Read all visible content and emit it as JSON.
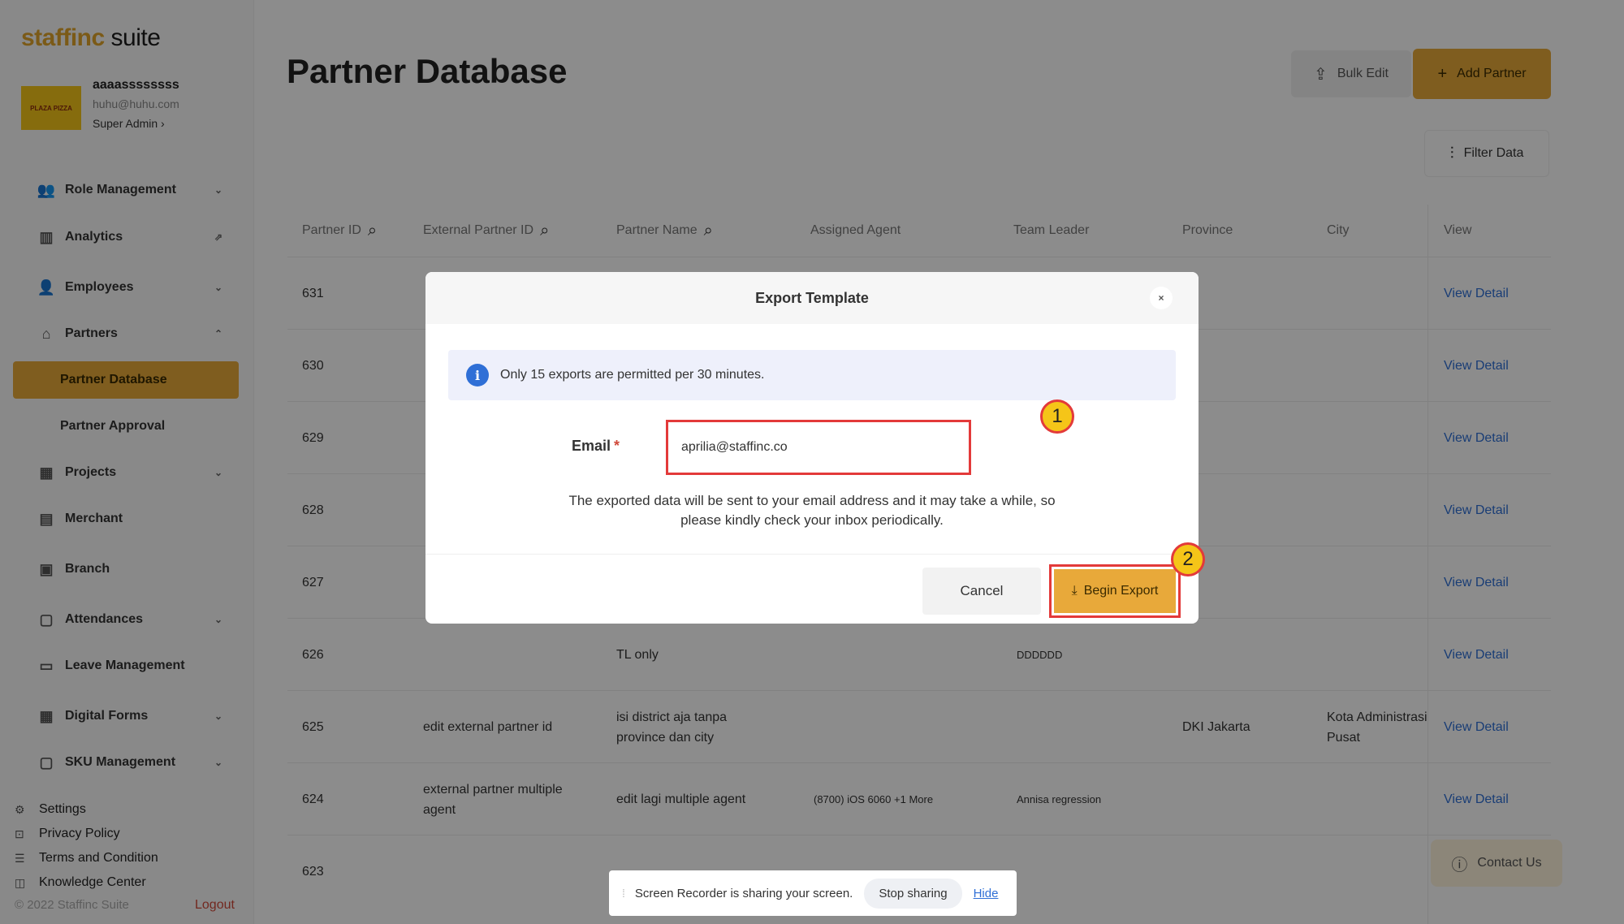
{
  "app": {
    "logo_part1": "staff",
    "logo_part2": "inc",
    "logo_part3": " suite",
    "avatar_text": "PLAZA PIZZA"
  },
  "profile": {
    "name": "aaaassssssss",
    "email": "huhu@huhu.com",
    "role": "Super Admin ›"
  },
  "sidebar": {
    "items": [
      {
        "label": "Role Management"
      },
      {
        "label": "Analytics"
      },
      {
        "label": "Employees"
      },
      {
        "label": "Partners"
      },
      {
        "label": "Partner Database"
      },
      {
        "label": "Partner Approval"
      },
      {
        "label": "Projects"
      },
      {
        "label": "Merchant"
      },
      {
        "label": "Branch"
      },
      {
        "label": "Attendances"
      },
      {
        "label": "Leave Management"
      },
      {
        "label": "Digital Forms"
      },
      {
        "label": "SKU Management"
      }
    ],
    "footer_links": [
      "Settings",
      "Privacy Policy",
      "Terms and Condition",
      "Knowledge Center"
    ],
    "copyright": "© 2022 Staffinc Suite",
    "logout": "Logout"
  },
  "header": {
    "title": "Partner Database",
    "bulk_edit": "Bulk Edit",
    "add_partner": "Add Partner",
    "filter_data": "Filter Data"
  },
  "table": {
    "columns": [
      "Partner ID",
      "External Partner ID",
      "Partner Name",
      "Assigned Agent",
      "Team Leader",
      "Province",
      "City",
      "View"
    ],
    "rows": [
      {
        "id": "631",
        "ext": "",
        "name": "",
        "agent": "",
        "leader": "",
        "province": "",
        "city": "",
        "view": "View Detail"
      },
      {
        "id": "630",
        "ext": "",
        "name": "",
        "agent": "",
        "leader": "",
        "province": "",
        "city": "",
        "view": "View Detail"
      },
      {
        "id": "629",
        "ext": "",
        "name": "",
        "agent": "",
        "leader": "",
        "province": "",
        "city": "",
        "view": "View Detail"
      },
      {
        "id": "628",
        "ext": "",
        "name": "",
        "agent": "",
        "leader": "",
        "province": "",
        "city": "",
        "view": "View Detail"
      },
      {
        "id": "627",
        "ext": "",
        "name": "",
        "agent": "",
        "leader": "",
        "province": "",
        "city": "",
        "view": "View Detail"
      },
      {
        "id": "626",
        "ext": "",
        "name": "TL only",
        "agent": "",
        "leader": "DDDDDD",
        "province": "",
        "city": "",
        "view": "View Detail"
      },
      {
        "id": "625",
        "ext": "edit external partner id",
        "name": "isi district aja tanpa province dan city",
        "agent": "",
        "leader": "",
        "province": "DKI Jakarta",
        "city": "Kota Administrasi Pusat",
        "view": "View Detail"
      },
      {
        "id": "624",
        "ext": "external partner multiple agent",
        "name": "edit lagi multiple agent",
        "agent": "(8700) iOS 6060   +1 More",
        "leader": "Annisa regression",
        "province": "",
        "city": "",
        "view": "View Detail"
      },
      {
        "id": "623",
        "ext": "",
        "name": "",
        "agent": "",
        "leader": "",
        "province": "",
        "city": "",
        "view": ""
      }
    ]
  },
  "contact": "Contact Us",
  "modal": {
    "title": "Export Template",
    "close": "×",
    "info": "Only 15 exports are permitted per 30 minutes.",
    "email_label": "Email",
    "required_mark": "*",
    "email_value": "aprilia@staffinc.co",
    "note_line1": "The exported data will be sent to your email address and it may take a while, so",
    "note_line2": "please kindly check your inbox periodically.",
    "cancel": "Cancel",
    "begin_export": "Begin Export"
  },
  "annotations": {
    "badge1": "1",
    "badge2": "2"
  },
  "sharebar": {
    "message": "Screen Recorder is sharing your screen.",
    "stop": "Stop sharing",
    "hide": "Hide"
  }
}
